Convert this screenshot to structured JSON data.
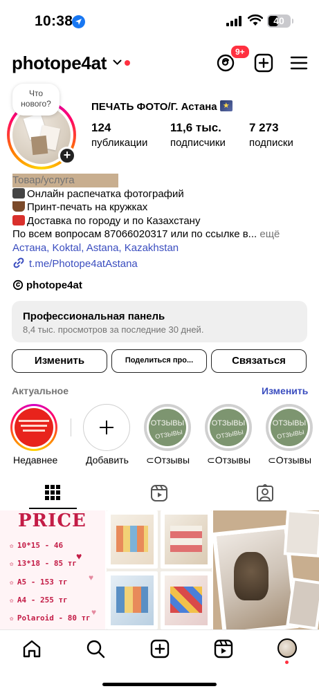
{
  "status_bar": {
    "time": "10:38",
    "battery": "40"
  },
  "header": {
    "username": "photope4at",
    "badge": "9+"
  },
  "profile": {
    "bubble_line1": "Что",
    "bubble_line2": "нового?",
    "name": "ПЕЧАТЬ ФОТО/Г. Астана",
    "stats": [
      {
        "num": "124",
        "label": "публикации"
      },
      {
        "num": "11,6 тыс.",
        "label": "подписчики"
      },
      {
        "num": "7 273",
        "label": "подписки"
      }
    ]
  },
  "bio": {
    "category": "Товар/услуга",
    "line1": "Онлайн распечатка фотографий",
    "line2": "Принт-печать на кружках",
    "line3": "Доставка по городу и по Казахстану",
    "line4": "По всем вопросам 87066020317 или по ссылке в...",
    "more": "ещё",
    "tags": "Астана, Koktal, Astana, Kazakhstan",
    "link": "t.me/Photope4atAstana",
    "threads": "photope4at"
  },
  "pro_panel": {
    "title": "Профессиональная панель",
    "subtitle": "8,4 тыс. просмотров за последние 30 дней."
  },
  "buttons": {
    "edit": "Изменить",
    "share": "Поделиться про...",
    "contact": "Связаться"
  },
  "highlights": {
    "title": "Актуальное",
    "edit": "Изменить",
    "items": [
      {
        "label": "Недавнее"
      },
      {
        "label": "Добавить"
      },
      {
        "label": "Отзывы",
        "text_top": "ОТЗЫВЫ",
        "text_bottom": "ОТЗЫВЫ"
      },
      {
        "label": "Отзывы",
        "text_top": "ОТЗЫВЫ",
        "text_bottom": "ОТЗЫВЫ"
      },
      {
        "label": "Отзывы",
        "text_top": "ОТЗЫВЫ",
        "text_bottom": "ОТЗЫВЫ"
      }
    ]
  },
  "grid": {
    "price": {
      "title": "PRICE",
      "rows": [
        "10*15 - 46",
        "13*18 - 85 тг",
        "А5 - 153 тг",
        "А4 - 255 тг",
        "Polaroid - 80 тг"
      ]
    }
  },
  "colors": {
    "accent": "#3a4dbf",
    "notification": "#ff3040",
    "highlight_green": "#7d9570"
  }
}
